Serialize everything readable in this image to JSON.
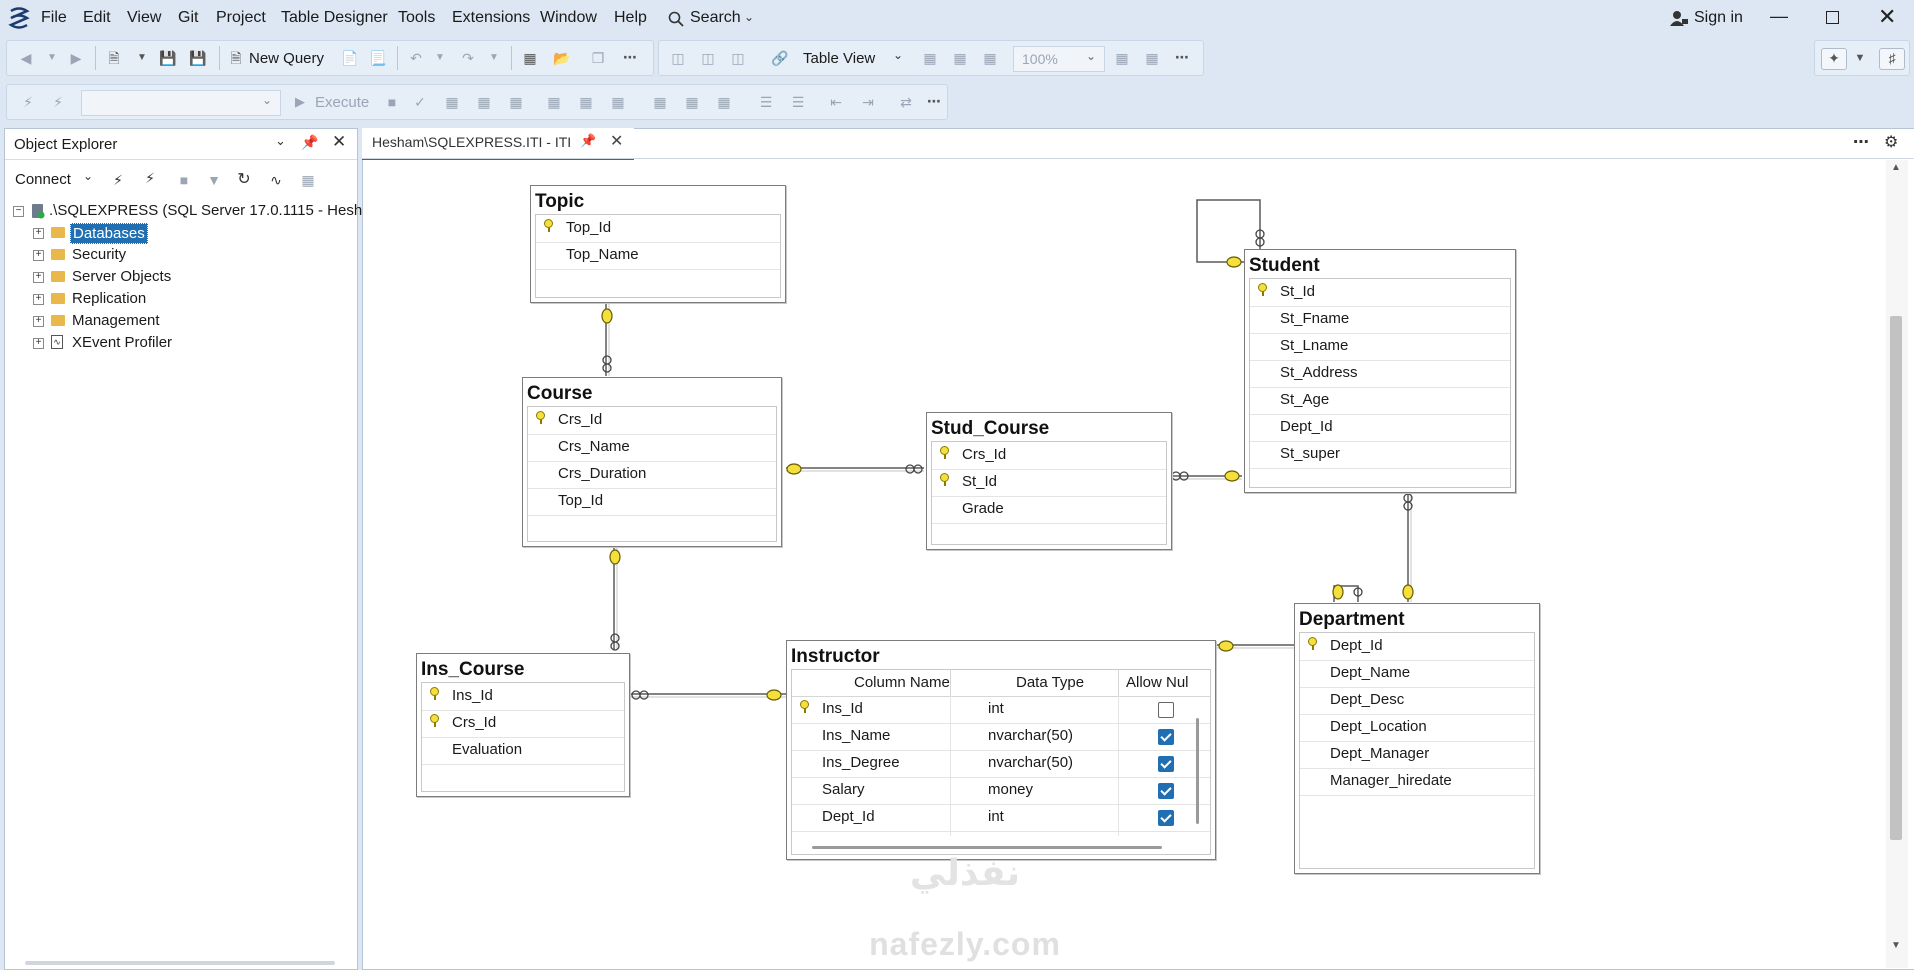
{
  "menu": [
    "File",
    "Edit",
    "View",
    "Git",
    "Project",
    "Table Designer",
    "Tools",
    "Extensions",
    "Window",
    "Help"
  ],
  "search_label": "Search",
  "sign_in_label": "Sign in",
  "toolbar": {
    "new_query_label": "New Query",
    "table_view_label": "Table View",
    "zoom_value": "100%",
    "execute_label": "Execute"
  },
  "object_explorer": {
    "title": "Object Explorer",
    "connect_label": "Connect",
    "server_label": ".\\SQLEXPRESS (SQL Server 17.0.1115 - Hesham",
    "nodes": [
      "Databases",
      "Security",
      "Server Objects",
      "Replication",
      "Management",
      "XEvent Profiler"
    ]
  },
  "document_tab": {
    "title": "Hesham\\SQLEXPRESS.ITI - ITI"
  },
  "tables": {
    "topic": {
      "name": "Topic",
      "columns": [
        "Top_Id",
        "Top_Name"
      ]
    },
    "course": {
      "name": "Course",
      "columns": [
        "Crs_Id",
        "Crs_Name",
        "Crs_Duration",
        "Top_Id"
      ]
    },
    "stud_course": {
      "name": "Stud_Course",
      "columns": [
        "Crs_Id",
        "St_Id",
        "Grade"
      ]
    },
    "student": {
      "name": "Student",
      "columns": [
        "St_Id",
        "St_Fname",
        "St_Lname",
        "St_Address",
        "St_Age",
        "Dept_Id",
        "St_super"
      ]
    },
    "ins_course": {
      "name": "Ins_Course",
      "columns": [
        "Ins_Id",
        "Crs_Id",
        "Evaluation"
      ]
    },
    "department": {
      "name": "Department",
      "columns": [
        "Dept_Id",
        "Dept_Name",
        "Dept_Desc",
        "Dept_Location",
        "Dept_Manager",
        "Manager_hiredate"
      ]
    },
    "instructor": {
      "name": "Instructor",
      "headers": [
        "Column Name",
        "Data Type",
        "Allow Nul"
      ],
      "rows": [
        {
          "name": "Ins_Id",
          "type": "int",
          "nullable": false
        },
        {
          "name": "Ins_Name",
          "type": "nvarchar(50)",
          "nullable": true
        },
        {
          "name": "Ins_Degree",
          "type": "nvarchar(50)",
          "nullable": true
        },
        {
          "name": "Salary",
          "type": "money",
          "nullable": true
        },
        {
          "name": "Dept_Id",
          "type": "int",
          "nullable": true
        }
      ]
    }
  },
  "watermark": {
    "arabic": "نفذلي",
    "latin": "nafezly.com"
  }
}
